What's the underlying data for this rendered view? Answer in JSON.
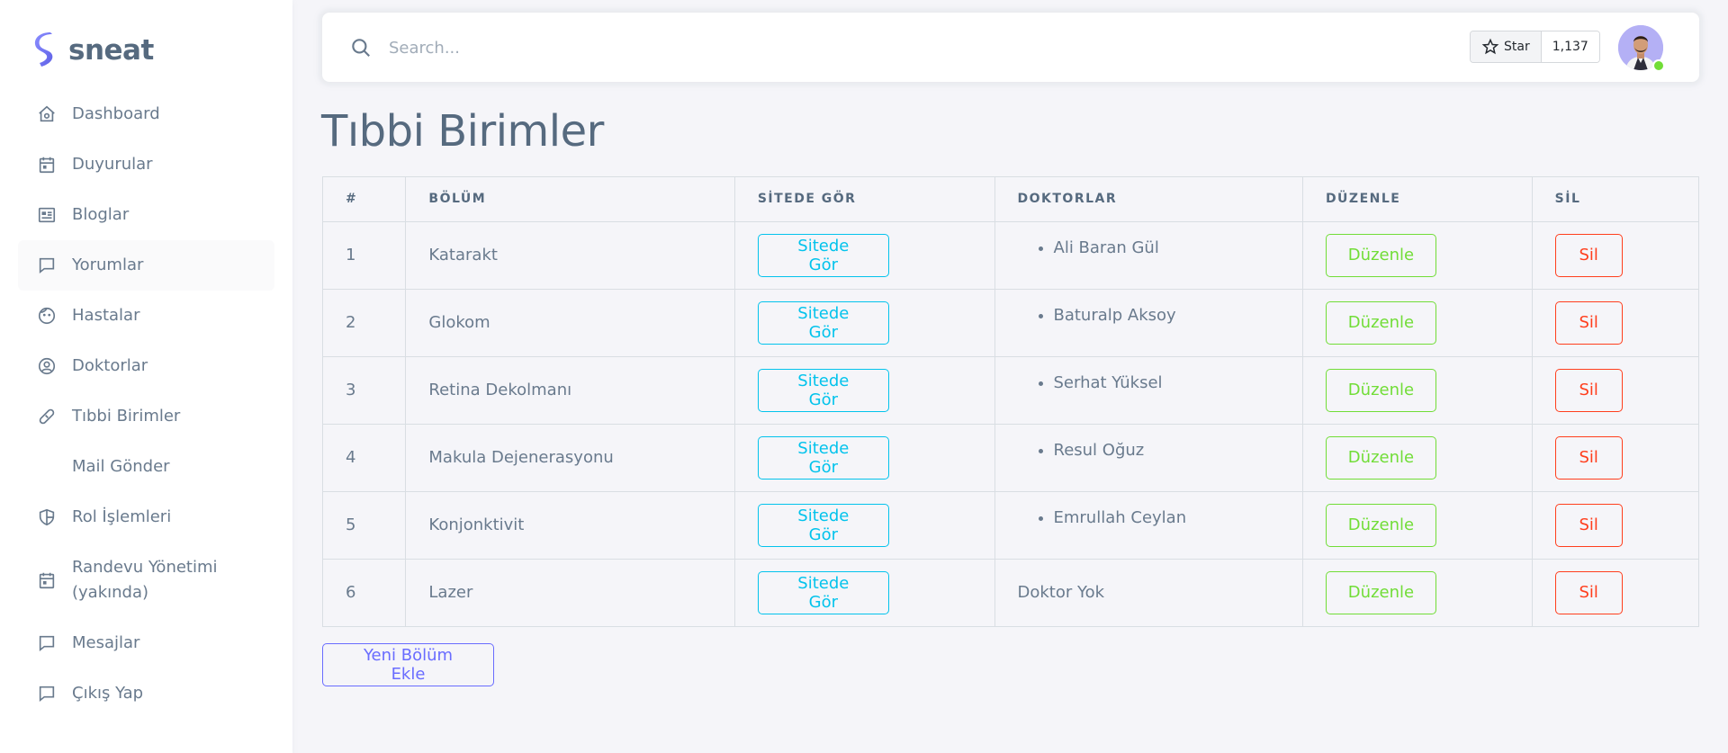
{
  "brand": {
    "name": "sneat"
  },
  "sidebar": {
    "items": [
      {
        "label": "Dashboard",
        "icon": "home-icon"
      },
      {
        "label": "Duyurular",
        "icon": "calendar-icon"
      },
      {
        "label": "Bloglar",
        "icon": "news-icon"
      },
      {
        "label": "Yorumlar",
        "icon": "message-icon"
      },
      {
        "label": "Hastalar",
        "icon": "face-icon"
      },
      {
        "label": "Doktorlar",
        "icon": "user-circle-icon"
      },
      {
        "label": "Tıbbi Birimler",
        "icon": "bandage-icon"
      },
      {
        "label": "Mail Gönder",
        "icon": ""
      },
      {
        "label": "Rol İşlemleri",
        "icon": "shield-icon"
      },
      {
        "label": "Randevu Yönetimi (yakında)",
        "icon": "calendar-event-icon"
      },
      {
        "label": "Mesajlar",
        "icon": "message-icon"
      },
      {
        "label": "Çıkış Yap",
        "icon": "message-icon"
      }
    ]
  },
  "navbar": {
    "search_placeholder": "Search...",
    "star_label": "Star",
    "star_count": "1,137"
  },
  "page": {
    "title": "Tıbbi Birimler"
  },
  "table": {
    "headers": [
      "#",
      "BÖLÜM",
      "SİTEDE GÖR",
      "DOKTORLAR",
      "DÜZENLE",
      "SİL"
    ],
    "rows": [
      {
        "id": "1",
        "department": "Katarakt",
        "view_label": "Sitede Gör",
        "doctors": [
          "Ali Baran Gül"
        ],
        "edit_label": "Düzenle",
        "delete_label": "Sil"
      },
      {
        "id": "2",
        "department": "Glokom",
        "view_label": "Sitede Gör",
        "doctors": [
          "Baturalp Aksoy"
        ],
        "edit_label": "Düzenle",
        "delete_label": "Sil"
      },
      {
        "id": "3",
        "department": "Retina Dekolmanı",
        "view_label": "Sitede Gör",
        "doctors": [
          "Serhat Yüksel"
        ],
        "edit_label": "Düzenle",
        "delete_label": "Sil"
      },
      {
        "id": "4",
        "department": "Makula Dejenerasyonu",
        "view_label": "Sitede Gör",
        "doctors": [
          "Resul Oğuz"
        ],
        "edit_label": "Düzenle",
        "delete_label": "Sil"
      },
      {
        "id": "5",
        "department": "Konjonktivit",
        "view_label": "Sitede Gör",
        "doctors": [
          "Emrullah Ceylan"
        ],
        "edit_label": "Düzenle",
        "delete_label": "Sil"
      },
      {
        "id": "6",
        "department": "Lazer",
        "view_label": "Sitede Gör",
        "doctors": [],
        "no_doctor_label": "Doktor Yok",
        "edit_label": "Düzenle",
        "delete_label": "Sil"
      }
    ]
  },
  "actions": {
    "add_label": "Yeni Bölüm Ekle"
  },
  "colors": {
    "primary": "#696cff",
    "info": "#03c3ec",
    "success": "#71dd37",
    "danger": "#ff3e1d",
    "text": "#697a8d",
    "heading": "#566a7f",
    "background": "#f5f5f9"
  }
}
